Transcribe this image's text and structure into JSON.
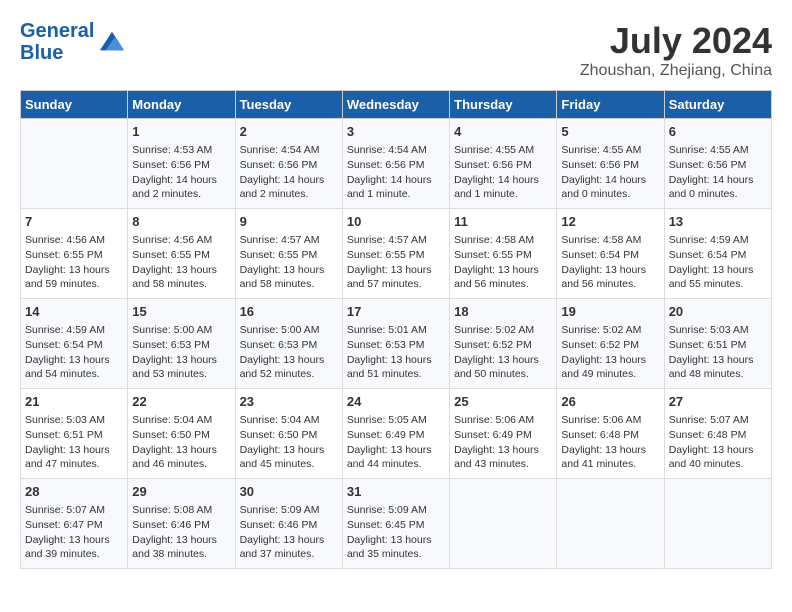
{
  "header": {
    "logo_line1": "General",
    "logo_line2": "Blue",
    "month": "July 2024",
    "location": "Zhoushan, Zhejiang, China"
  },
  "weekdays": [
    "Sunday",
    "Monday",
    "Tuesday",
    "Wednesday",
    "Thursday",
    "Friday",
    "Saturday"
  ],
  "weeks": [
    [
      {
        "day": "",
        "info": ""
      },
      {
        "day": "1",
        "info": "Sunrise: 4:53 AM\nSunset: 6:56 PM\nDaylight: 14 hours\nand 2 minutes."
      },
      {
        "day": "2",
        "info": "Sunrise: 4:54 AM\nSunset: 6:56 PM\nDaylight: 14 hours\nand 2 minutes."
      },
      {
        "day": "3",
        "info": "Sunrise: 4:54 AM\nSunset: 6:56 PM\nDaylight: 14 hours\nand 1 minute."
      },
      {
        "day": "4",
        "info": "Sunrise: 4:55 AM\nSunset: 6:56 PM\nDaylight: 14 hours\nand 1 minute."
      },
      {
        "day": "5",
        "info": "Sunrise: 4:55 AM\nSunset: 6:56 PM\nDaylight: 14 hours\nand 0 minutes."
      },
      {
        "day": "6",
        "info": "Sunrise: 4:55 AM\nSunset: 6:56 PM\nDaylight: 14 hours\nand 0 minutes."
      }
    ],
    [
      {
        "day": "7",
        "info": "Sunrise: 4:56 AM\nSunset: 6:55 PM\nDaylight: 13 hours\nand 59 minutes."
      },
      {
        "day": "8",
        "info": "Sunrise: 4:56 AM\nSunset: 6:55 PM\nDaylight: 13 hours\nand 58 minutes."
      },
      {
        "day": "9",
        "info": "Sunrise: 4:57 AM\nSunset: 6:55 PM\nDaylight: 13 hours\nand 58 minutes."
      },
      {
        "day": "10",
        "info": "Sunrise: 4:57 AM\nSunset: 6:55 PM\nDaylight: 13 hours\nand 57 minutes."
      },
      {
        "day": "11",
        "info": "Sunrise: 4:58 AM\nSunset: 6:55 PM\nDaylight: 13 hours\nand 56 minutes."
      },
      {
        "day": "12",
        "info": "Sunrise: 4:58 AM\nSunset: 6:54 PM\nDaylight: 13 hours\nand 56 minutes."
      },
      {
        "day": "13",
        "info": "Sunrise: 4:59 AM\nSunset: 6:54 PM\nDaylight: 13 hours\nand 55 minutes."
      }
    ],
    [
      {
        "day": "14",
        "info": "Sunrise: 4:59 AM\nSunset: 6:54 PM\nDaylight: 13 hours\nand 54 minutes."
      },
      {
        "day": "15",
        "info": "Sunrise: 5:00 AM\nSunset: 6:53 PM\nDaylight: 13 hours\nand 53 minutes."
      },
      {
        "day": "16",
        "info": "Sunrise: 5:00 AM\nSunset: 6:53 PM\nDaylight: 13 hours\nand 52 minutes."
      },
      {
        "day": "17",
        "info": "Sunrise: 5:01 AM\nSunset: 6:53 PM\nDaylight: 13 hours\nand 51 minutes."
      },
      {
        "day": "18",
        "info": "Sunrise: 5:02 AM\nSunset: 6:52 PM\nDaylight: 13 hours\nand 50 minutes."
      },
      {
        "day": "19",
        "info": "Sunrise: 5:02 AM\nSunset: 6:52 PM\nDaylight: 13 hours\nand 49 minutes."
      },
      {
        "day": "20",
        "info": "Sunrise: 5:03 AM\nSunset: 6:51 PM\nDaylight: 13 hours\nand 48 minutes."
      }
    ],
    [
      {
        "day": "21",
        "info": "Sunrise: 5:03 AM\nSunset: 6:51 PM\nDaylight: 13 hours\nand 47 minutes."
      },
      {
        "day": "22",
        "info": "Sunrise: 5:04 AM\nSunset: 6:50 PM\nDaylight: 13 hours\nand 46 minutes."
      },
      {
        "day": "23",
        "info": "Sunrise: 5:04 AM\nSunset: 6:50 PM\nDaylight: 13 hours\nand 45 minutes."
      },
      {
        "day": "24",
        "info": "Sunrise: 5:05 AM\nSunset: 6:49 PM\nDaylight: 13 hours\nand 44 minutes."
      },
      {
        "day": "25",
        "info": "Sunrise: 5:06 AM\nSunset: 6:49 PM\nDaylight: 13 hours\nand 43 minutes."
      },
      {
        "day": "26",
        "info": "Sunrise: 5:06 AM\nSunset: 6:48 PM\nDaylight: 13 hours\nand 41 minutes."
      },
      {
        "day": "27",
        "info": "Sunrise: 5:07 AM\nSunset: 6:48 PM\nDaylight: 13 hours\nand 40 minutes."
      }
    ],
    [
      {
        "day": "28",
        "info": "Sunrise: 5:07 AM\nSunset: 6:47 PM\nDaylight: 13 hours\nand 39 minutes."
      },
      {
        "day": "29",
        "info": "Sunrise: 5:08 AM\nSunset: 6:46 PM\nDaylight: 13 hours\nand 38 minutes."
      },
      {
        "day": "30",
        "info": "Sunrise: 5:09 AM\nSunset: 6:46 PM\nDaylight: 13 hours\nand 37 minutes."
      },
      {
        "day": "31",
        "info": "Sunrise: 5:09 AM\nSunset: 6:45 PM\nDaylight: 13 hours\nand 35 minutes."
      },
      {
        "day": "",
        "info": ""
      },
      {
        "day": "",
        "info": ""
      },
      {
        "day": "",
        "info": ""
      }
    ]
  ]
}
